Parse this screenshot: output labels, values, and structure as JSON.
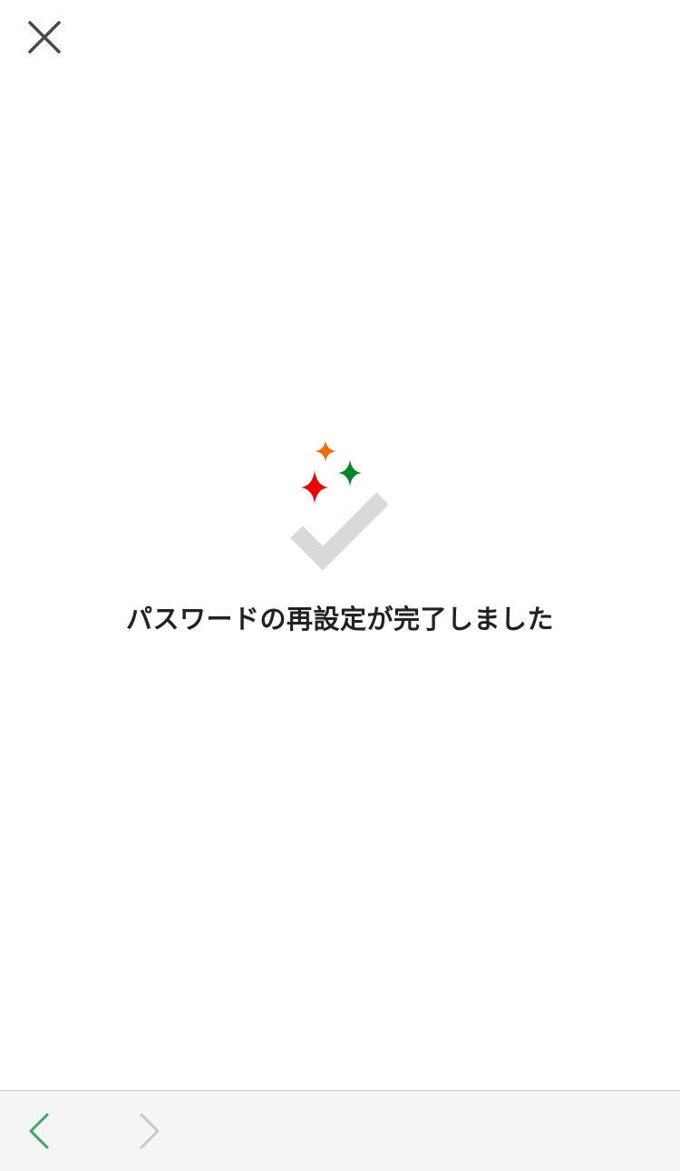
{
  "header": {
    "close_icon": "close-icon"
  },
  "main": {
    "illustration_icons": [
      "sparkle-icon",
      "sparkle-icon",
      "sparkle-icon",
      "check-icon"
    ],
    "message": "パスワードの再設定が完了しました"
  },
  "colors": {
    "sparkle_orange": "#f26b00",
    "sparkle_green": "#068527",
    "sparkle_red": "#ee0000",
    "check_gray": "#d9d9d9",
    "back_arrow_green": "#3aa865",
    "forward_arrow_gray": "#c8c8c8",
    "toolbar_bg": "#f5f5f5"
  },
  "toolbar": {
    "back_icon": "chevron-left-icon",
    "forward_icon": "chevron-right-icon"
  }
}
